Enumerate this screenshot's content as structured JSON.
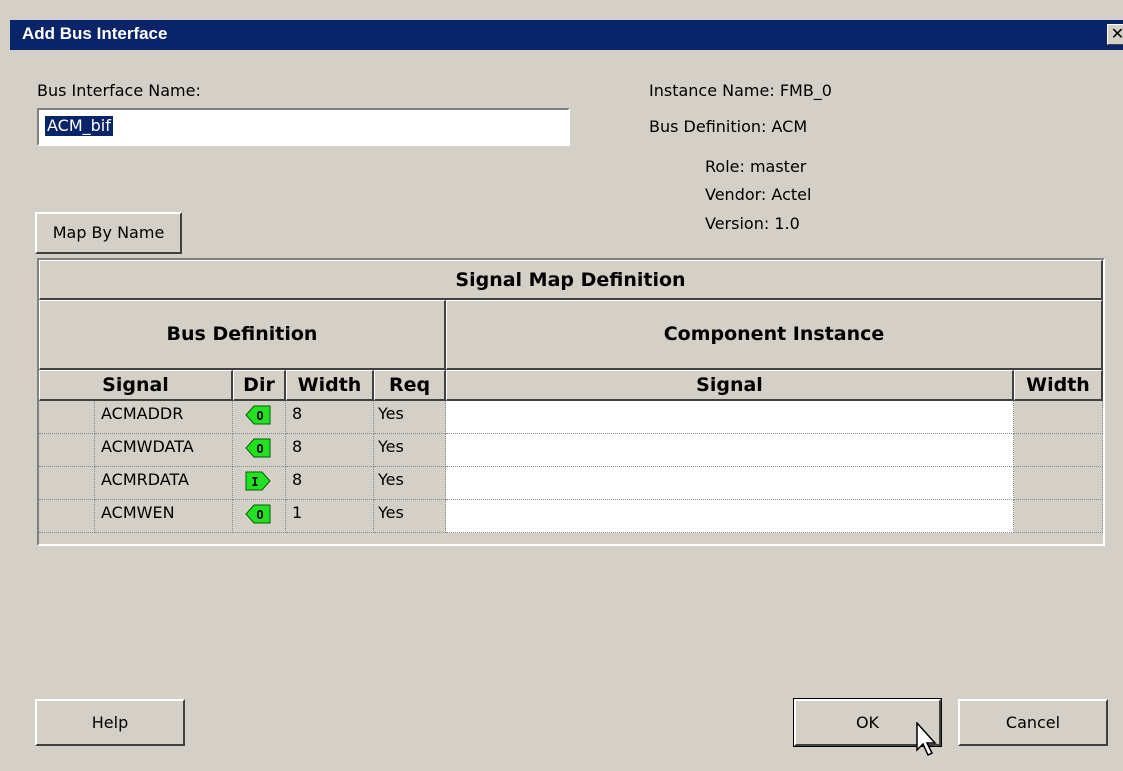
{
  "window": {
    "title": "Add Bus Interface",
    "close_glyph": "✕"
  },
  "form": {
    "bus_interface_name_label": "Bus Interface Name:",
    "bus_interface_name_value": "ACM_bif",
    "map_by_name_label": "Map By Name"
  },
  "info": {
    "instance_name": "Instance Name: FMB_0",
    "bus_definition": "Bus Definition: ACM",
    "role": "Role: master",
    "vendor": "Vendor: Actel",
    "version": "Version: 1.0"
  },
  "table": {
    "title": "Signal Map Definition",
    "group_bus": "Bus Definition",
    "group_component": "Component Instance",
    "columns": {
      "signal": "Signal",
      "dir": "Dir",
      "width": "Width",
      "req": "Req",
      "comp_signal": "Signal",
      "comp_width": "Width"
    },
    "rows": [
      {
        "signal": "ACMADDR",
        "dir": "O",
        "width": "8",
        "req": "Yes",
        "comp_signal": "",
        "comp_width": ""
      },
      {
        "signal": "ACMWDATA",
        "dir": "O",
        "width": "8",
        "req": "Yes",
        "comp_signal": "",
        "comp_width": ""
      },
      {
        "signal": "ACMRDATA",
        "dir": "I",
        "width": "8",
        "req": "Yes",
        "comp_signal": "",
        "comp_width": ""
      },
      {
        "signal": "ACMWEN",
        "dir": "O",
        "width": "1",
        "req": "Yes",
        "comp_signal": "",
        "comp_width": ""
      }
    ]
  },
  "buttons": {
    "help": "Help",
    "ok": "OK",
    "cancel": "Cancel"
  },
  "colors": {
    "title_bar": "#0a246a",
    "dialog_bg": "#d4d0c8",
    "dir_icon": "#22e022"
  }
}
